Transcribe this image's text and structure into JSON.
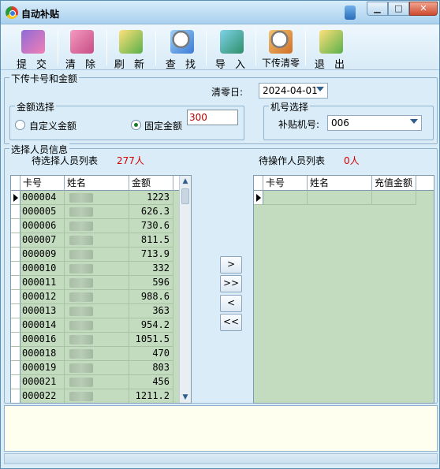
{
  "window": {
    "title": "自动补贴"
  },
  "toolbar": {
    "items": [
      {
        "label": "提 交",
        "icon": "submit-icon"
      },
      {
        "label": "清 除",
        "icon": "clear-icon"
      },
      {
        "label": "刷 新",
        "icon": "refresh-icon"
      },
      {
        "label": "查 找",
        "icon": "find-icon"
      },
      {
        "label": "导 入",
        "icon": "import-icon"
      },
      {
        "label": "下传清零",
        "icon": "upload-clear-icon"
      },
      {
        "label": "退 出",
        "icon": "exit-icon"
      }
    ]
  },
  "upload_group": {
    "title": "下传卡号和金额",
    "clear_date_label": "清零日:",
    "clear_date_value": "2024-04-01",
    "amount_group": {
      "title": "金额选择",
      "custom_label": "自定义金额",
      "fixed_label": "固定金额",
      "selected": "fixed",
      "fixed_value": "300"
    },
    "machine_group": {
      "title": "机号选择",
      "label": "补贴机号:",
      "value": "006"
    }
  },
  "people_group": {
    "title": "选择人员信息",
    "pending_label": "待选择人员列表",
    "pending_count": "277人",
    "operate_label": "待操作人员列表",
    "operate_count": "0人"
  },
  "left_grid": {
    "columns": [
      "卡号",
      "姓名",
      "金额"
    ],
    "rows": [
      {
        "id": "000004",
        "amount": "1223"
      },
      {
        "id": "000005",
        "amount": "626.3"
      },
      {
        "id": "000006",
        "amount": "730.6"
      },
      {
        "id": "000007",
        "amount": "811.5"
      },
      {
        "id": "000009",
        "amount": "713.9"
      },
      {
        "id": "000010",
        "amount": "332"
      },
      {
        "id": "000011",
        "amount": "596"
      },
      {
        "id": "000012",
        "amount": "988.6"
      },
      {
        "id": "000013",
        "amount": "363"
      },
      {
        "id": "000014",
        "amount": "954.2"
      },
      {
        "id": "000016",
        "amount": "1051.5"
      },
      {
        "id": "000018",
        "amount": "470"
      },
      {
        "id": "000019",
        "amount": "803"
      },
      {
        "id": "000021",
        "amount": "456"
      },
      {
        "id": "000022",
        "amount": "1211.2"
      }
    ]
  },
  "right_grid": {
    "columns": [
      "卡号",
      "姓名",
      "充值金额"
    ]
  },
  "move_buttons": {
    "move_one": ">",
    "move_all": ">>",
    "back_one": "<",
    "back_all": "<<"
  },
  "colors": {
    "window_bg": "#d9ecf7",
    "grid_bg": "#c3dcc0",
    "count_red": "#d40000"
  }
}
